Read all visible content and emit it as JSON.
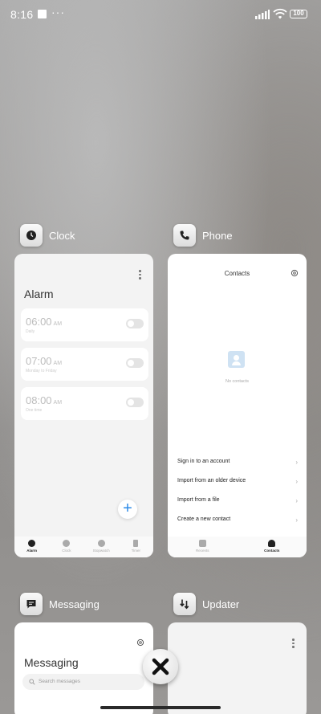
{
  "status_bar": {
    "time": "8:16",
    "overflow": "···",
    "battery": "100"
  },
  "apps": [
    {
      "name": "Clock"
    },
    {
      "name": "Phone"
    },
    {
      "name": "Messaging"
    },
    {
      "name": "Updater"
    }
  ],
  "clock_card": {
    "title": "Alarm",
    "alarms": [
      {
        "time": "06:00",
        "ampm": "AM",
        "sub": "Daily"
      },
      {
        "time": "07:00",
        "ampm": "AM",
        "sub": "Monday to Friday"
      },
      {
        "time": "08:00",
        "ampm": "AM",
        "sub": "One time"
      }
    ],
    "fab": "+",
    "tabs": [
      "Alarm",
      "Clock",
      "Stopwatch",
      "Timer"
    ],
    "active_tab": "Alarm"
  },
  "phone_card": {
    "title": "Contacts",
    "empty_text": "No contacts",
    "options": [
      "Sign in to an account",
      "Import from an older device",
      "Import from a file",
      "Create a new contact"
    ],
    "tabs": [
      "Recents",
      "Contacts"
    ],
    "active_tab": "Contacts"
  },
  "messaging_card": {
    "title": "Messaging",
    "search_placeholder": "Search messages"
  },
  "colors": {
    "accent": "#2b8ae8",
    "close": "#111111"
  }
}
